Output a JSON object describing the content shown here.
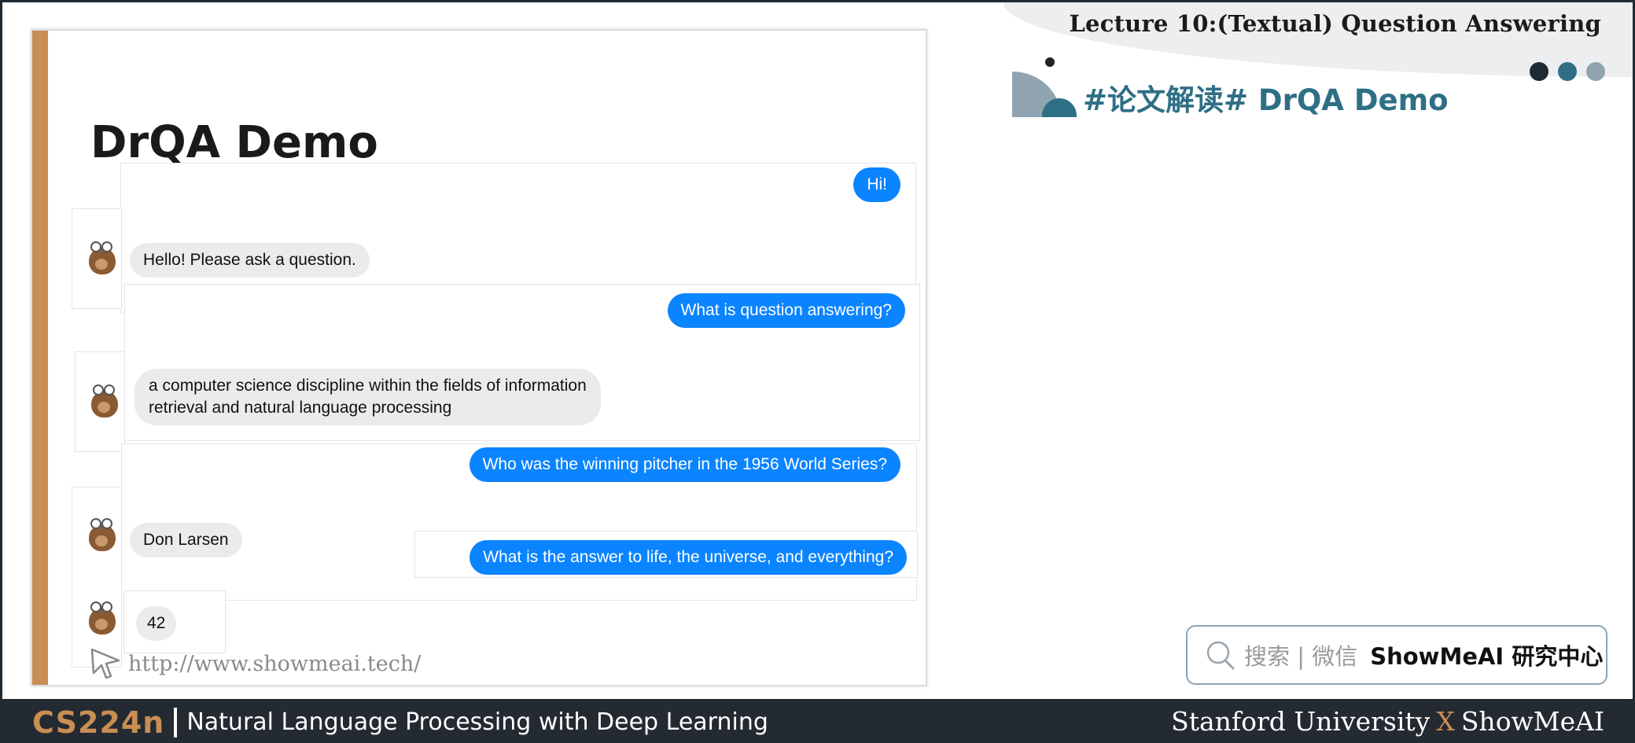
{
  "header": {
    "lecture_title": "Lecture 10:(Textual) Question Answering",
    "section_title": "#论文解读# DrQA Demo",
    "dot_colors": [
      "#1f2a33",
      "#2f6f86",
      "#8fa3b1"
    ]
  },
  "slide": {
    "title": "DrQA Demo",
    "accent_color": "#c98e54",
    "messages": [
      {
        "role": "user",
        "text": "Hi!"
      },
      {
        "role": "bot",
        "text": "Hello! Please ask a question."
      },
      {
        "role": "user",
        "text": "What is question answering?"
      },
      {
        "role": "bot",
        "line1": "a computer science discipline within the fields of information",
        "line2": "retrieval and natural language processing"
      },
      {
        "role": "user",
        "text": "Who was the winning pitcher in the 1956 World Series?"
      },
      {
        "role": "bot",
        "text": "Don Larsen"
      },
      {
        "role": "user",
        "text": "What is the answer to life, the universe, and everything?"
      },
      {
        "role": "bot",
        "text": "42"
      }
    ],
    "url": "http://www.showmeai.tech/",
    "user_bubble_color": "#0b84ff",
    "bot_bubble_color": "#ebebeb"
  },
  "search": {
    "label": "搜索 | 微信",
    "brand": "ShowMeAI 研究中心"
  },
  "footer": {
    "course_code": "CS224n",
    "course_name": "Natural Language Processing with Deep Learning",
    "left_org": "Stanford University",
    "x": "X",
    "right_org": "ShowMeAI"
  }
}
